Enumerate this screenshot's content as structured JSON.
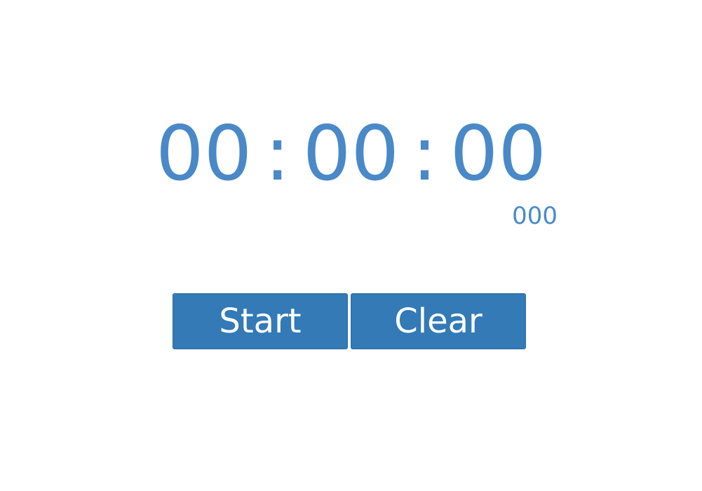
{
  "timer": {
    "hours": "00",
    "minutes": "00",
    "seconds": "00",
    "separator": ":",
    "milliseconds": "000"
  },
  "controls": {
    "start_label": "Start",
    "clear_label": "Clear"
  },
  "colors": {
    "time_text": "#4a89c8",
    "button_bg": "#337ab7",
    "button_text": "#ffffff",
    "background": "#ffffff"
  }
}
